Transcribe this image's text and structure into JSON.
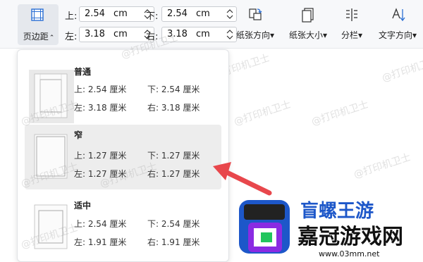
{
  "ribbon": {
    "margins_button": {
      "label": "页边距",
      "caret": "⌃"
    },
    "top": {
      "label": "上:",
      "value": "2.54",
      "unit": "cm"
    },
    "bottom": {
      "label": "下:",
      "value": "2.54",
      "unit": "cm"
    },
    "left": {
      "label": "左:",
      "value": "3.18",
      "unit": "cm"
    },
    "right": {
      "label": "右:",
      "value": "3.18",
      "unit": "cm"
    },
    "tools": [
      {
        "label": "纸张方向",
        "icon": "orientation-icon"
      },
      {
        "label": "纸张大小",
        "icon": "paper-size-icon"
      },
      {
        "label": "分栏",
        "icon": "columns-icon"
      },
      {
        "label": "文字方向",
        "icon": "text-direction-icon"
      }
    ]
  },
  "presets": [
    {
      "name": "普通",
      "top": "上: 2.54 厘米",
      "bottom": "下: 2.54 厘米",
      "left": "左: 3.18 厘米",
      "right": "右: 3.18 厘米"
    },
    {
      "name": "窄",
      "top": "上: 1.27 厘米",
      "bottom": "下: 1.27 厘米",
      "left": "左: 1.27 厘米",
      "right": "右: 1.27 厘米"
    },
    {
      "name": "适中",
      "top": "上: 2.54 厘米",
      "bottom": "下: 2.54 厘米",
      "left": "左: 1.91 厘米",
      "right": "右: 1.91 厘米"
    }
  ],
  "watermark": "@打印机卫士",
  "logo": {
    "title": "嘉冠游戏网",
    "url": "www.03mm.net",
    "partial": "盲螺王游"
  },
  "colors": {
    "accent": "#e8474c",
    "logo_blue": "#1d57c9",
    "logo_purple": "#8a2be2"
  }
}
